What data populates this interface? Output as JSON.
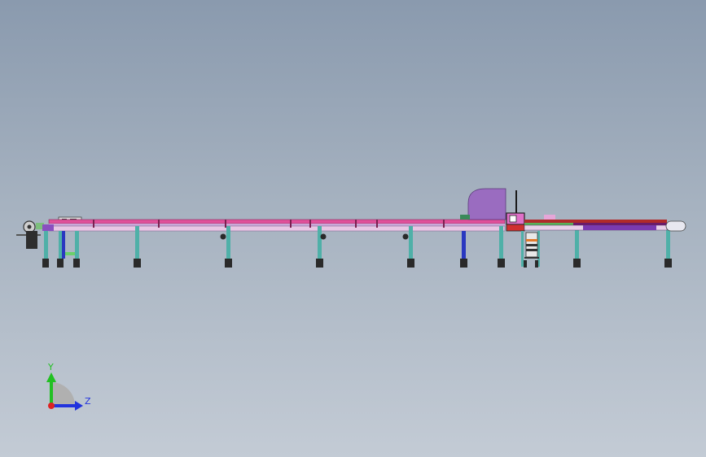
{
  "model_view": {
    "projection": "side elevation",
    "parts": [
      "feed-roller",
      "conveyor-rail",
      "support-legs",
      "saw-blade-guard",
      "clamp-unit",
      "motor-assembly",
      "outfeed-roller-table",
      "end-roller"
    ],
    "colors": {
      "rail": "#e0509a",
      "rail_lower": "#c9a9d8",
      "leg": "#4fb0a8",
      "guard": "#9a6cc0",
      "outfeed": "#b02a2a",
      "foot": "#2a2a2a"
    }
  },
  "triad": {
    "y_label": "Y",
    "z_label": "Z",
    "colors": {
      "y": "#22c022",
      "z": "#2233dd",
      "origin": "#dd2222"
    }
  }
}
